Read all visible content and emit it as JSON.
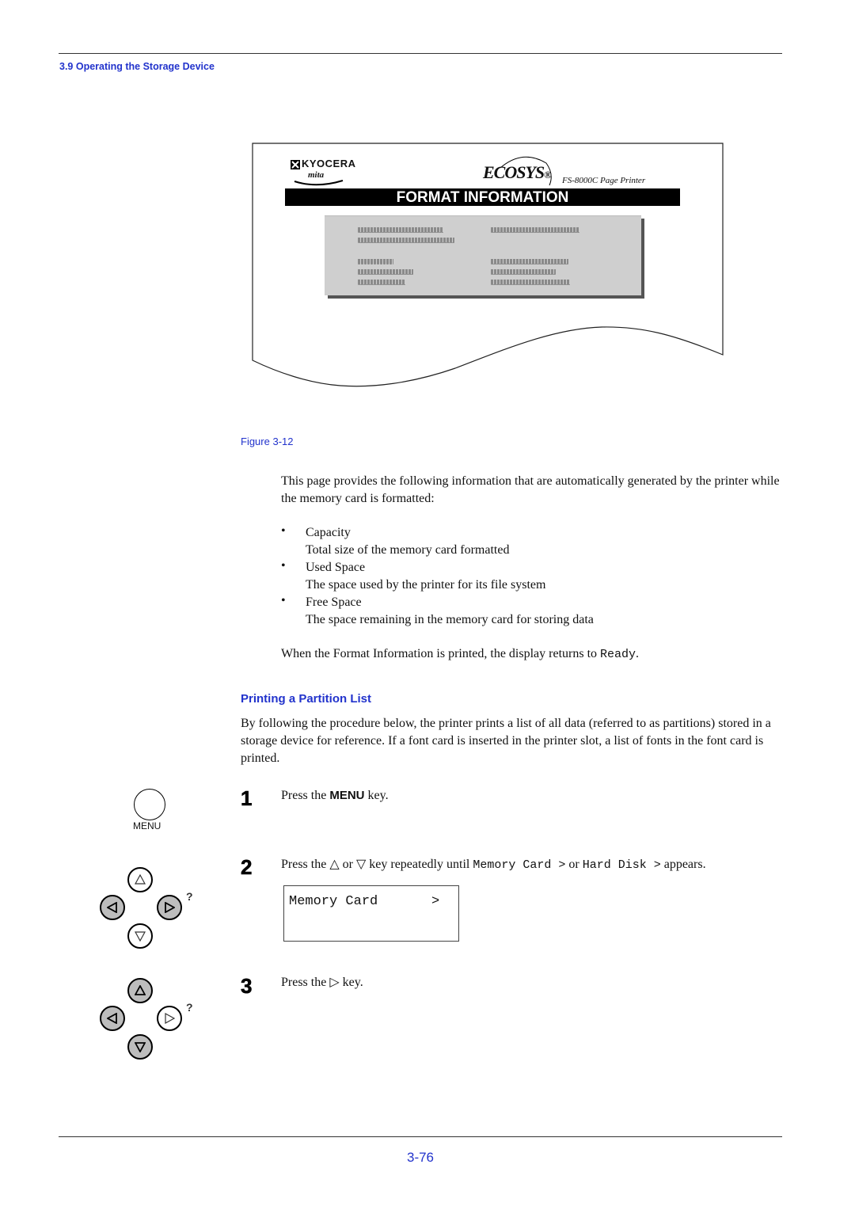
{
  "header": {
    "section_title": "3.9 Operating the Storage Device"
  },
  "figure": {
    "printout": {
      "brand_logo": "KYOCERA",
      "brand_sub": "mita",
      "product_logo": "ECOSYS",
      "product_logo_mark": "®",
      "model": "FS-8000C  Page Printer",
      "title": "FORMAT INFORMATION"
    },
    "caption": "Figure 3-12"
  },
  "body": {
    "intro": "This page provides the following information that are automatically generated by the printer while the memory card is formatted:",
    "bullet_glyph": "•",
    "items": [
      {
        "term": "Capacity",
        "desc": "Total size of the memory card formatted"
      },
      {
        "term": "Used Space",
        "desc": "The space used by the printer for its file system"
      },
      {
        "term": "Free Space",
        "desc": "The space remaining in the memory card for storing data"
      }
    ],
    "return_text_pre": "When the Format Information is printed, the display returns to ",
    "return_text_code": "Ready",
    "return_text_post": "."
  },
  "partition_section": {
    "heading": "Printing a Partition List",
    "description": "By following the procedure below, the printer prints a list of all data (referred to as partitions) stored in a storage device for reference. If a font card is inserted in the printer slot, a list of fonts in the font card is printed.",
    "steps": [
      {
        "number": "1",
        "text_pre": "Press the ",
        "text_key": "MENU",
        "text_post": " key."
      },
      {
        "number": "2",
        "text_pre": "Press the △ or ▽ key repeatedly until ",
        "code1": "Memory Card >",
        "text_mid": " or ",
        "code2": "Hard Disk >",
        "text_post": " appears."
      },
      {
        "number": "3",
        "text": "Press the ▷ key."
      }
    ],
    "lcd": {
      "line1": "Memory Card",
      "arrow": ">"
    },
    "menu_key_label": "MENU",
    "help_mark": "?"
  },
  "footer": {
    "page_number": "3-76"
  },
  "colors": {
    "accent_blue": "#2233cc",
    "key_pressed_gray": "#bdbdbd"
  }
}
